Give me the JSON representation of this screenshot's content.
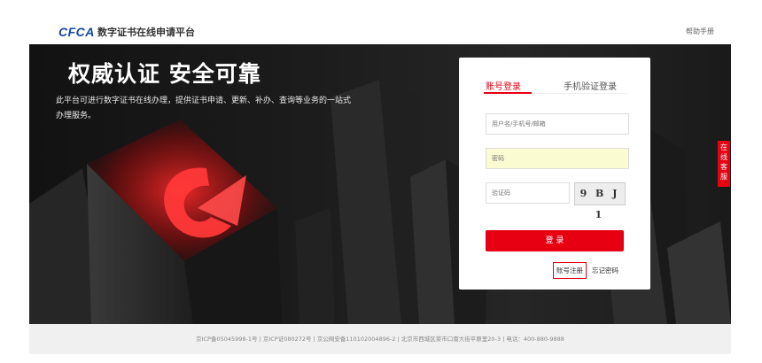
{
  "header": {
    "logo_text": "CFCA",
    "site_title": "数字证书在线申请平台",
    "help_link": "帮助手册"
  },
  "banner": {
    "headline": "权威认证 安全可靠",
    "description": "此平台可进行数字证书在线办理，提供证书申请、更新、补办、查询等业务的一站式办理服务。"
  },
  "login": {
    "tabs": [
      "账号登录",
      "手机验证登录"
    ],
    "active_tab": "账号登录",
    "username_placeholder": "用户名/手机号/邮箱",
    "password_placeholder": "密码",
    "captcha_placeholder": "验证码",
    "captcha_text": "9 B J 1",
    "login_button": "登 录",
    "register_link": "账号注册",
    "forgot_link": "忘记密码"
  },
  "side_tab": {
    "label": "在线客服"
  },
  "footer": {
    "text": "京ICP备05045998-1号 | 京ICP证080272号 | 京公网安备110102004896-2 | 北京市西城区菜市口南大街平原里20-3 | 电话：400-880-9888"
  },
  "colors": {
    "accent": "#e60012",
    "logo_blue": "#1747a6",
    "banner_bg": "#1c1c1c"
  }
}
